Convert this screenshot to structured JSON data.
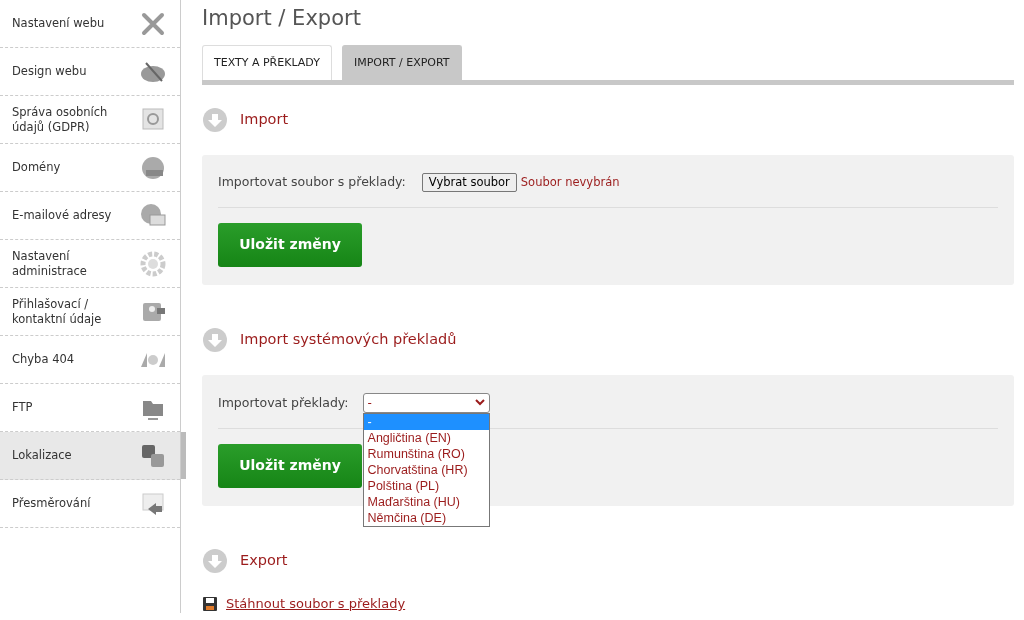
{
  "sidebar": {
    "items": [
      {
        "label": "Nastavení webu",
        "selected": false
      },
      {
        "label": "Design webu",
        "selected": false
      },
      {
        "label": "Správa osobních údajů (GDPR)",
        "selected": false
      },
      {
        "label": "Domény",
        "selected": false
      },
      {
        "label": "E-mailové adresy",
        "selected": false
      },
      {
        "label": "Nastavení administrace",
        "selected": false
      },
      {
        "label": "Přihlašovací / kontaktní údaje",
        "selected": false
      },
      {
        "label": "Chyba 404",
        "selected": false
      },
      {
        "label": "FTP",
        "selected": false
      },
      {
        "label": "Lokalizace",
        "selected": true
      },
      {
        "label": "Přesměrování",
        "selected": false
      }
    ]
  },
  "page_title": "Import / Export",
  "tabs": [
    {
      "label": "TEXTY A PŘEKLADY",
      "selected": false
    },
    {
      "label": "IMPORT / EXPORT",
      "selected": true
    }
  ],
  "import": {
    "heading": "Import",
    "field_label": "Importovat soubor s překlady:",
    "file_button": "Vybrat soubor",
    "file_status": "Soubor nevybrán",
    "save_button": "Uložit změny"
  },
  "system_import": {
    "heading": "Import systémových překladů",
    "field_label": "Importovat překlady:",
    "value": "-",
    "expanded": true,
    "options": [
      {
        "label": "-",
        "selected": true
      },
      {
        "label": "Angličtina (EN)",
        "selected": false
      },
      {
        "label": "Rumunština (RO)",
        "selected": false
      },
      {
        "label": "Chorvatština (HR)",
        "selected": false
      },
      {
        "label": "Polština (PL)",
        "selected": false
      },
      {
        "label": "Maďarština (HU)",
        "selected": false
      },
      {
        "label": "Němčina (DE)",
        "selected": false
      }
    ],
    "save_button": "Uložit změny"
  },
  "export": {
    "heading": "Export",
    "link": "Stáhnout soubor s překlady"
  }
}
